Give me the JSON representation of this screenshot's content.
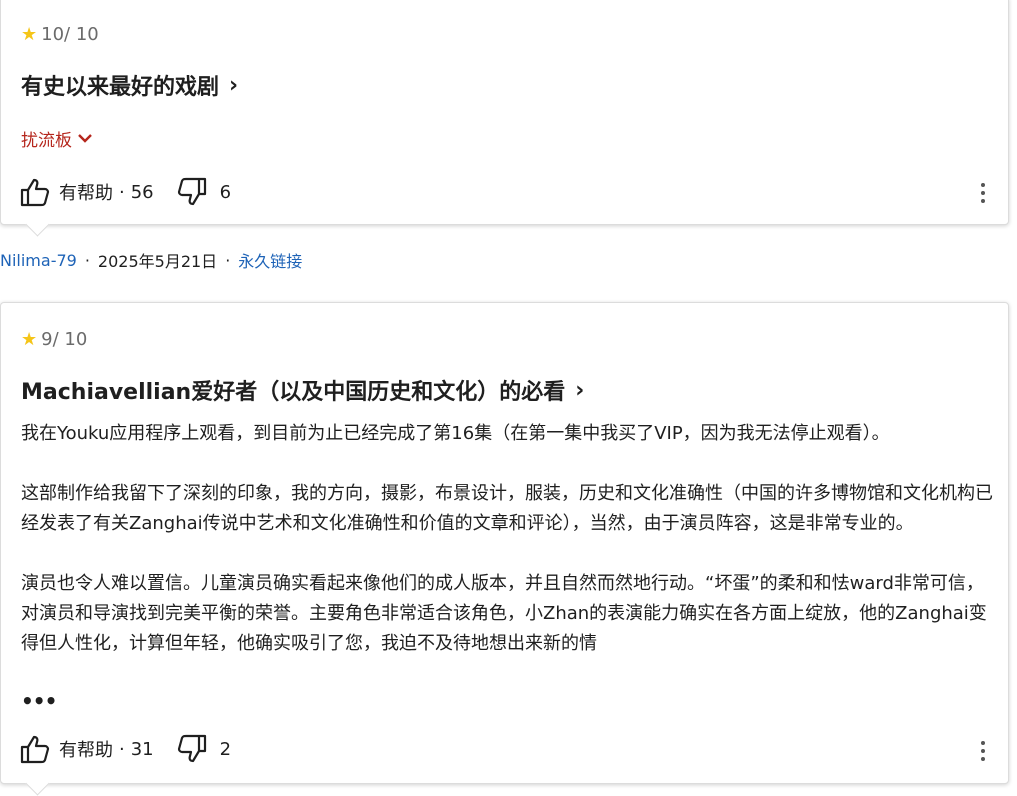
{
  "reviews": [
    {
      "rating": "10/ 10",
      "title": "有史以来最好的戏剧",
      "spoiler_label": "扰流板",
      "helpful_label": "有帮助",
      "helpful_count": "56",
      "unhelpful_count": "6"
    },
    {
      "rating": "9/ 10",
      "title": "Machiavellian爱好者（以及中国历史和文化）的必看",
      "body": "我在Youku应用程序上观看，到目前为止已经完成了第16集（在第一集中我买了VIP，因为我无法停止观看）。\n\n这部制作给我留下了深刻的印象，我的方向，摄影，布景设计，服装，历史和文化准确性（中国的许多博物馆和文化机构已经发表了有关Zanghai传说中艺术和文化准确性和价值的文章和评论），当然，由于演员阵容，这是非常专业的。\n\n演员也令人难以置信。儿童演员确实看起来像他们的成人版本，并且自然而然地行动。“坏蛋”的柔和和怯ward非常可信，对演员和导演找到完美平衡的荣誉。主要角色非常适合该角色，小Zhan的表演能力确实在各方面上绽放，他的Zanghai变得但人性化，计算但年轻，他确实吸引了您，我迫不及待地想出来新的情",
      "helpful_label": "有帮助",
      "helpful_count": "31",
      "unhelpful_count": "2"
    }
  ],
  "meta": {
    "author": "Nilima-79",
    "date": "2025年5月21日",
    "permalink": "永久链接"
  },
  "separator": "·",
  "icons": {
    "star": "star-icon",
    "thumb_up": "thumb-up-icon",
    "thumb_down": "thumb-down-icon",
    "chevron_right": "chevron-right-icon",
    "chevron_down": "chevron-down-icon",
    "more": "more-vert-icon",
    "expand": "more-horiz-icon"
  },
  "colors": {
    "star": "#f5c518",
    "spoiler": "#b5261c",
    "link": "#1e63b7"
  }
}
